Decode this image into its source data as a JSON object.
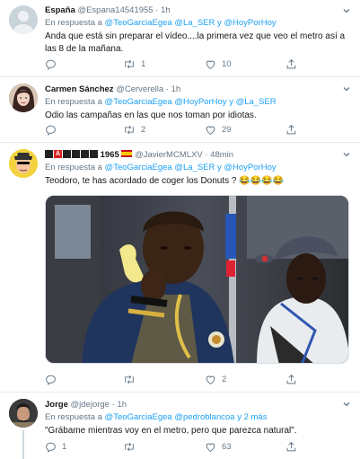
{
  "tweets": [
    {
      "name": "España",
      "handle": "@Espana14541955",
      "time": "1h",
      "reply_prefix": "En respuesta a",
      "reply_mentions": [
        "@TeoGarciaEgea",
        "@La_SER"
      ],
      "reply_joiner": "y",
      "reply_last": "@HoyPorHoy",
      "text": "Anda que está sin preparar el vídeo....la primera vez que veo el metro así a las 8 de la mañana.",
      "counts": {
        "reply": "",
        "retweet": "1",
        "like": "10"
      }
    },
    {
      "name": "Carmen Sánchez",
      "handle": "@Cerverella",
      "time": "1h",
      "reply_prefix": "En respuesta a",
      "reply_mentions": [
        "@TeoGarciaEgea",
        "@HoyPorHoy"
      ],
      "reply_joiner": "y",
      "reply_last": "@La_SER",
      "text": "Odio las campañas en las que nos toman por idiotas.",
      "counts": {
        "reply": "",
        "retweet": "2",
        "like": "29"
      }
    },
    {
      "name_prefix": "1965",
      "flag": "ES",
      "handle": "@JavierMCMLXV",
      "time": "48min",
      "reply_prefix": "En respuesta a",
      "reply_mentions": [
        "@TeoGarciaEgea",
        "@La_SER"
      ],
      "reply_joiner": "y",
      "reply_last": "@HoyPorHoy",
      "text": "Teodoro, te has acordado de coger los Donuts ? 😂😂😂😂",
      "counts": {
        "reply": "",
        "retweet": "",
        "like": "2"
      }
    },
    {
      "name": "Jorge",
      "handle": "@jdejorge",
      "time": "1h",
      "reply_prefix": "En respuesta a",
      "reply_mentions": [
        "@TeoGarciaEgea",
        "@pedroblancoa"
      ],
      "reply_joiner": "y",
      "reply_last": "2 más",
      "text": "\"Grábame mientras voy en el metro, pero que parezca natural\".",
      "counts": {
        "reply": "1",
        "retweet": "",
        "like": "63"
      }
    }
  ],
  "colors": {
    "accent": "#1da1f2",
    "muted": "#657786",
    "text": "#14171a",
    "border": "#e6ecf0"
  },
  "icons": [
    "reply-icon",
    "retweet-icon",
    "like-icon",
    "share-icon",
    "chevron-down-icon"
  ]
}
